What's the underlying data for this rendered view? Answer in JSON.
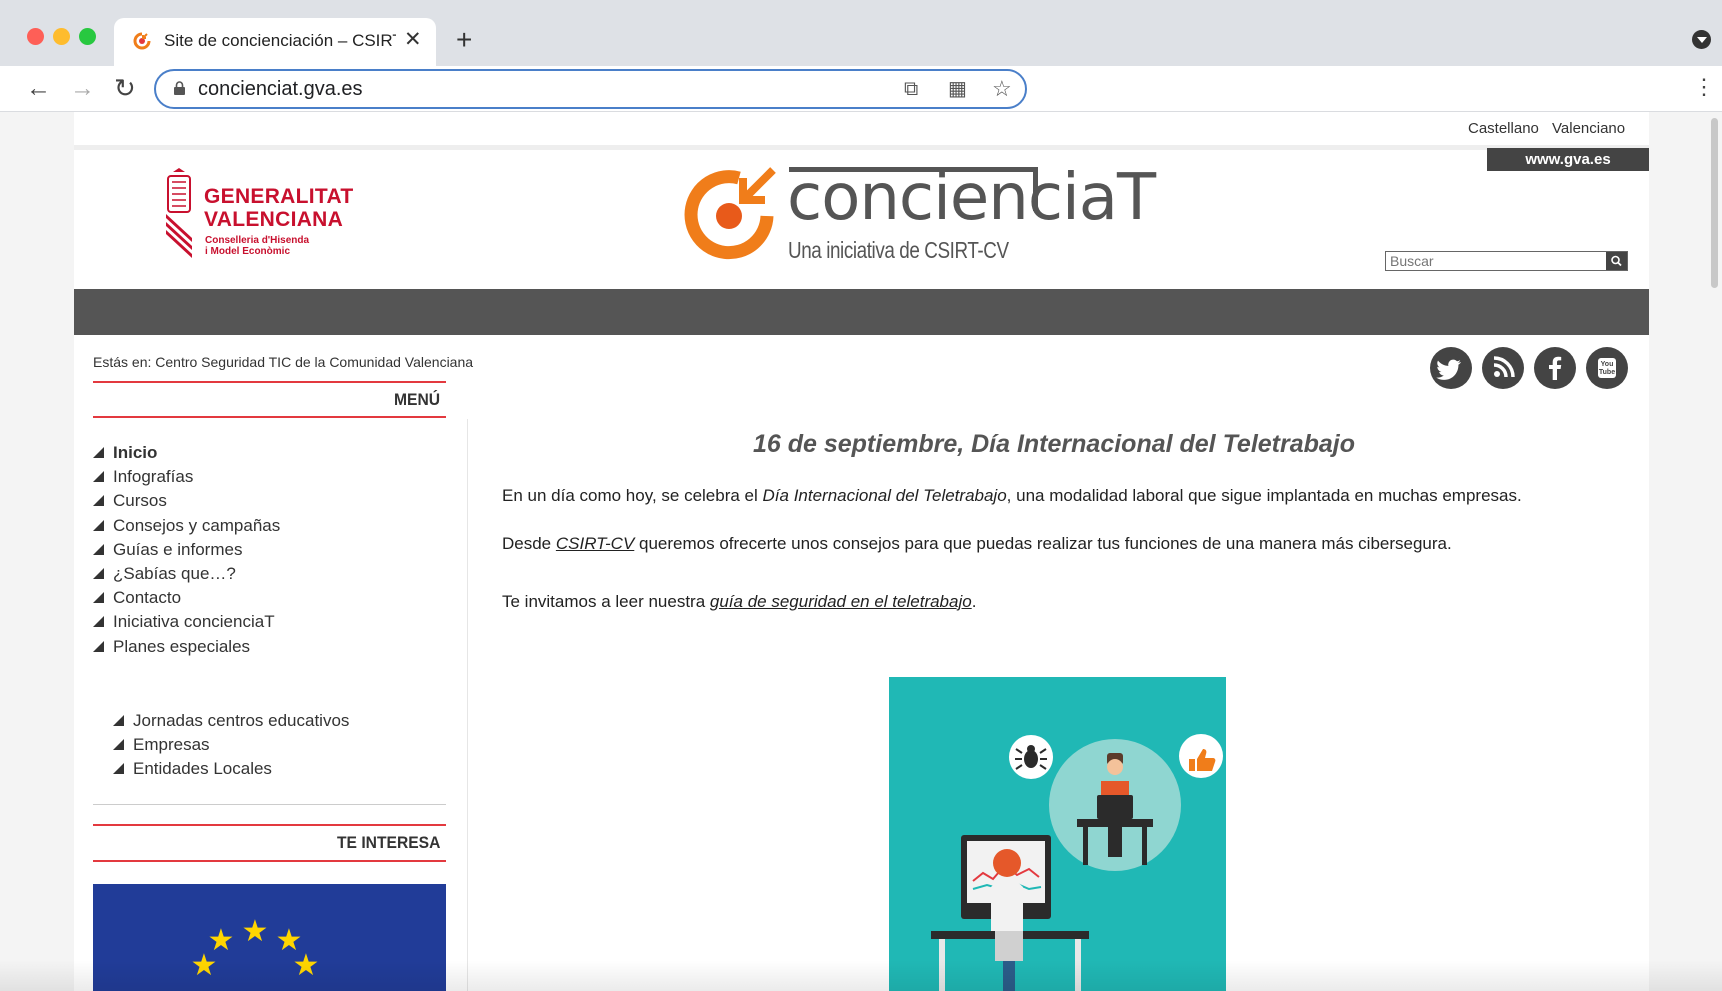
{
  "browser": {
    "tab_title": "Site de concienciación – CSIRT-CV",
    "tab_close": "✕",
    "new_tab": "+",
    "url": "concienciat.gva.es",
    "back": "←",
    "forward": "→",
    "reload": "↻",
    "menu": "⋮"
  },
  "header": {
    "lang_es": "Castellano",
    "lang_va": "Valenciano",
    "gva_link": "www.gva.es",
    "gva_name_1": "GENERALITAT",
    "gva_name_2": "VALENCIANA",
    "gva_sub_1": "Conselleria d'Hisenda",
    "gva_sub_2": "i Model Econòmic",
    "brand_word": "concienciaT",
    "brand_tagline": "Una iniciativa de CSIRT-CV",
    "search_placeholder": "Buscar"
  },
  "breadcrumb": "Estás en: Centro Seguridad TIC de la Comunidad Valenciana",
  "social": [
    "twitter-icon",
    "rss-icon",
    "facebook-icon",
    "youtube-icon"
  ],
  "sidebar": {
    "menu_title": "MENÚ",
    "items": [
      {
        "label": "Inicio"
      },
      {
        "label": "Infografías"
      },
      {
        "label": "Cursos"
      },
      {
        "label": "Consejos y campañas"
      },
      {
        "label": "Guías e informes"
      },
      {
        "label": "¿Sabías que…?"
      },
      {
        "label": "Contacto"
      },
      {
        "label": "Iniciativa concienciaT"
      },
      {
        "label": "Planes especiales"
      }
    ],
    "subitems": [
      {
        "label": "Jornadas centros educativos"
      },
      {
        "label": "Empresas"
      },
      {
        "label": "Entidades Locales"
      }
    ],
    "interest_title": "TE INTERESA"
  },
  "article": {
    "title": "16 de septiembre, Día Internacional del Teletrabajo",
    "p1_a": "En un día como hoy, se celebra el ",
    "p1_em": "Día Internacional del Teletrabajo",
    "p1_b": ", una modalidad laboral que sigue implantada en muchas empresas.",
    "p2_a": "Desde ",
    "p2_link": "CSIRT-CV",
    "p2_b": " queremos ofrecerte unos consejos para que puedas realizar tus funciones de una manera más cibersegura.",
    "p3_a": "Te invitamos a leer nuestra ",
    "p3_link": "guía de seguridad en el teletrabajo",
    "p3_b": "."
  },
  "colors": {
    "brand_orange": "#f07d1a",
    "gva_red": "#c8102e",
    "accent_rule": "#e3393f",
    "dark_bar": "#555555",
    "illustration_bg": "#20b8b5"
  }
}
